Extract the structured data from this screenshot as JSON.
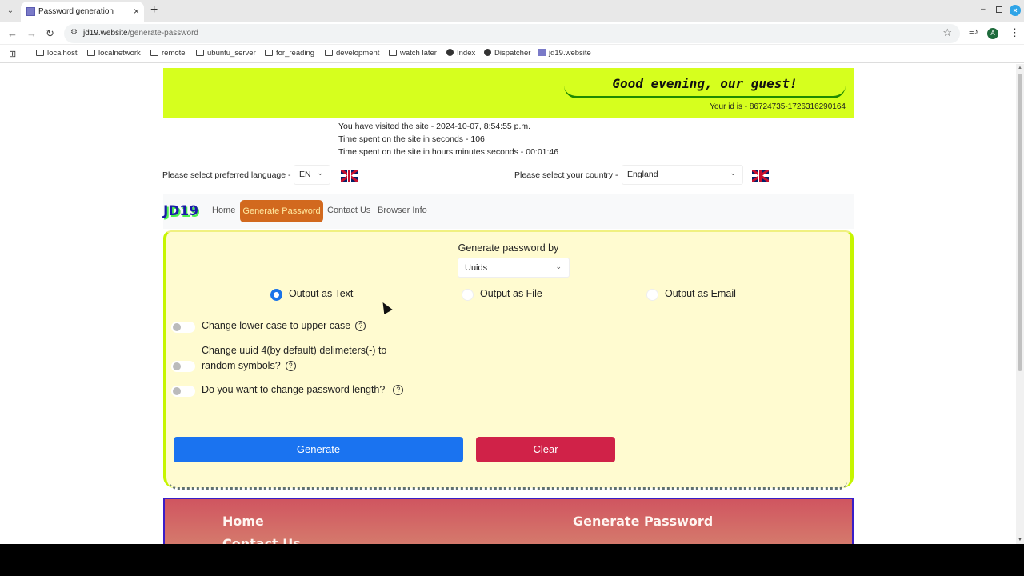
{
  "browser": {
    "tab": {
      "title": "Password generation",
      "close": "×"
    },
    "new_tab": "+",
    "tab_list": "⌄",
    "window_controls": {
      "minimize": "–",
      "close": "×"
    },
    "nav": {
      "back": "←",
      "forward": "→",
      "reload": "↻"
    },
    "url": {
      "host": "jd19.website",
      "path": "/generate-password"
    },
    "star": "☆",
    "media": "≡♪",
    "profile_initial": "A",
    "menu": "⋮",
    "apps_icon": "⊞",
    "bookmarks": [
      {
        "label": "localhost",
        "icon": "folder"
      },
      {
        "label": "localnetwork",
        "icon": "folder"
      },
      {
        "label": "remote",
        "icon": "folder"
      },
      {
        "label": "ubuntu_server",
        "icon": "folder"
      },
      {
        "label": "for_reading",
        "icon": "folder"
      },
      {
        "label": "development",
        "icon": "folder"
      },
      {
        "label": "watch later",
        "icon": "folder"
      },
      {
        "label": "Index",
        "icon": "globe"
      },
      {
        "label": "Dispatcher",
        "icon": "globe"
      },
      {
        "label": "jd19.website",
        "icon": "favicon"
      }
    ]
  },
  "header": {
    "greeting": "Good evening, our guest!",
    "user_id": "Your id is - 86724735-1726316290164",
    "banner_color": "#d6ff1e"
  },
  "visit_info": {
    "visited": "You have visited the site - 2024-10-07, 8:54:55 p.m.",
    "seconds": "Time spent on the site in seconds - 106",
    "hms": "Time spent on the site in hours:minutes:seconds - 00:01:46"
  },
  "language": {
    "label": "Please select preferred language -",
    "value": "EN",
    "flag": "uk-flag"
  },
  "country": {
    "label": "Please select your country -",
    "value": "England",
    "flag": "uk-flag"
  },
  "navbar": {
    "logo": "JD19",
    "links": [
      "Home",
      "Generate Password",
      "Contact Us",
      "Browser Info"
    ],
    "active": "Generate Password"
  },
  "form": {
    "generate_by_label": "Generate password by",
    "generate_by_value": "Uuids",
    "output_options": [
      {
        "label": "Output as Text",
        "checked": true
      },
      {
        "label": "Output as File",
        "checked": false
      },
      {
        "label": "Output as Email",
        "checked": false
      }
    ],
    "toggles": [
      {
        "line1": "Change lower case to upper case",
        "line2": "",
        "on": false
      },
      {
        "line1": "Change uuid 4(by default) delimeters(-) to",
        "line2": "random symbols?",
        "on": false
      },
      {
        "line1": "Do you want to change password length?",
        "line2": "",
        "on": false
      }
    ],
    "help_glyph": "?",
    "generate_label": "Generate",
    "clear_label": "Clear",
    "generate_color": "#1a73f0",
    "clear_color": "#d02248"
  },
  "footer": {
    "links": [
      "Home",
      "Generate Password",
      "Contact Us"
    ]
  }
}
